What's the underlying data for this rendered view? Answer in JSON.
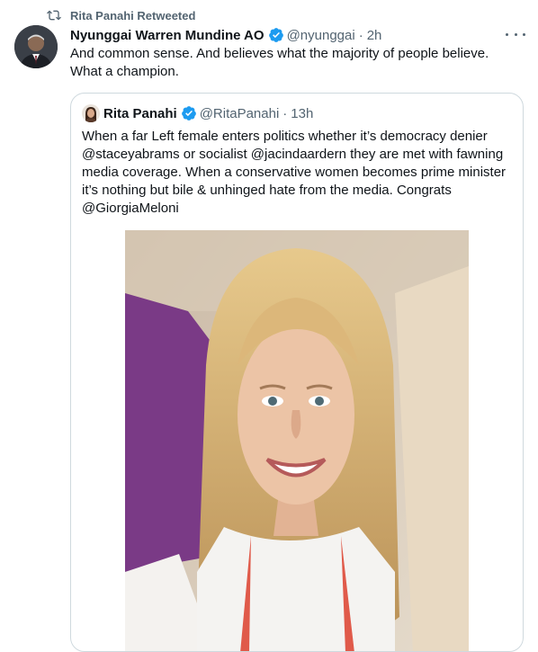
{
  "retweet": {
    "label": "Rita Panahi Retweeted",
    "icon": "retweet-icon"
  },
  "tweet": {
    "author_name": "Nyunggai Warren Mundine AO",
    "handle": "@nyunggai",
    "separator": "·",
    "time": "2h",
    "text": "And common sense. And believes what the majority of people believe. What a champion."
  },
  "quoted_tweet": {
    "author_name": "Rita Panahi",
    "handle": "@RitaPanahi",
    "separator": "·",
    "time": "13h",
    "text": "When a far Left female enters politics whether it’s democracy denier @staceyabrams or socialist @jacindaardern they are met with fawning media coverage. When a conservative women becomes prime minister it’s nothing but bile & unhinged hate from the media. Congrats @GiorgiaMeloni"
  },
  "colors": {
    "accent": "#1d9bf0",
    "secondary_text": "#536471",
    "border": "#cfd9de"
  }
}
